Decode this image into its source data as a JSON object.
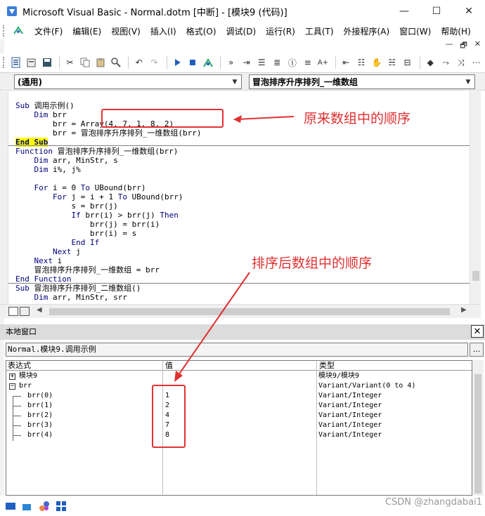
{
  "window": {
    "title": "Microsoft Visual Basic - Normal.dotm [中断] - [模块9 (代码)]",
    "buttons": {
      "minimize": "—",
      "maximize": "☐",
      "close": "✕"
    }
  },
  "menu": [
    "文件(F)",
    "编辑(E)",
    "视图(V)",
    "插入(I)",
    "格式(O)",
    "调试(D)",
    "运行(R)",
    "工具(T)",
    "外接程序(A)",
    "窗口(W)",
    "帮助(H)"
  ],
  "mdi": {
    "minimize": "—",
    "restore": "🗗",
    "close": "✕"
  },
  "combos": {
    "object": "(通用)",
    "procedure": "冒泡排序升序排列_一维数组"
  },
  "code": {
    "lines": [
      {
        "segments": [
          {
            "t": "Sub ",
            "kw": true
          },
          {
            "t": "调用示例()"
          }
        ]
      },
      {
        "segments": [
          {
            "t": "    "
          },
          {
            "t": "Dim",
            "kw": true
          },
          {
            "t": " brr"
          }
        ]
      },
      {
        "segments": [
          {
            "t": "        brr = Array(4, 7, 1, 8, 2)"
          }
        ]
      },
      {
        "segments": [
          {
            "t": "        brr = 冒泡排序升序排列_一维数组(brr)"
          }
        ]
      },
      {
        "segments": [
          {
            "t": "End Sub",
            "kw": true,
            "hl": true
          }
        ]
      },
      {
        "segments": [
          {
            "t": "Function ",
            "kw": true
          },
          {
            "t": "冒泡排序升序排列_一维数组(brr)"
          }
        ]
      },
      {
        "segments": [
          {
            "t": "    "
          },
          {
            "t": "Dim",
            "kw": true
          },
          {
            "t": " arr, MinStr, s"
          }
        ]
      },
      {
        "segments": [
          {
            "t": "    "
          },
          {
            "t": "Dim",
            "kw": true
          },
          {
            "t": " i%, j%"
          }
        ]
      },
      {
        "segments": [
          {
            "t": ""
          }
        ]
      },
      {
        "segments": [
          {
            "t": "    "
          },
          {
            "t": "For",
            "kw": true
          },
          {
            "t": " i = 0 "
          },
          {
            "t": "To",
            "kw": true
          },
          {
            "t": " UBound(brr)"
          }
        ]
      },
      {
        "segments": [
          {
            "t": "        "
          },
          {
            "t": "For",
            "kw": true
          },
          {
            "t": " j = i + 1 "
          },
          {
            "t": "To",
            "kw": true
          },
          {
            "t": " UBound(brr)"
          }
        ]
      },
      {
        "segments": [
          {
            "t": "            s = brr(j)"
          }
        ]
      },
      {
        "segments": [
          {
            "t": "            "
          },
          {
            "t": "If",
            "kw": true
          },
          {
            "t": " brr(i) > brr(j) "
          },
          {
            "t": "Then",
            "kw": true
          }
        ]
      },
      {
        "segments": [
          {
            "t": "                brr(j) = brr(i)"
          }
        ]
      },
      {
        "segments": [
          {
            "t": "                brr(i) = s"
          }
        ]
      },
      {
        "segments": [
          {
            "t": "            "
          },
          {
            "t": "End If",
            "kw": true
          }
        ]
      },
      {
        "segments": [
          {
            "t": "        "
          },
          {
            "t": "Next",
            "kw": true
          },
          {
            "t": " j"
          }
        ]
      },
      {
        "segments": [
          {
            "t": "    "
          },
          {
            "t": "Next",
            "kw": true
          },
          {
            "t": " i"
          }
        ]
      },
      {
        "segments": [
          {
            "t": "    冒泡排序升序排列_一维数组 = brr"
          }
        ]
      },
      {
        "segments": [
          {
            "t": "End Function",
            "kw": true
          }
        ]
      },
      {
        "segments": [
          {
            "t": "Sub ",
            "kw": true
          },
          {
            "t": "冒泡排序升序排列_二维数组()"
          }
        ]
      },
      {
        "segments": [
          {
            "t": "    "
          },
          {
            "t": "Dim",
            "kw": true
          },
          {
            "t": " arr, MinStr, srr"
          }
        ]
      }
    ]
  },
  "locals": {
    "title": "本地窗口",
    "close": "✕",
    "context": "Normal.模块9.调用示例",
    "context_button": "...",
    "headers": {
      "expr": "表达式",
      "value": "值",
      "type": "类型"
    },
    "rows": [
      {
        "expr": "模块9",
        "value": "",
        "type": "模块9/模块9",
        "expander": "+"
      },
      {
        "expr": "brr",
        "value": "",
        "type": "Variant/Variant(0 to 4)",
        "expander": "−"
      },
      {
        "expr": "brr(0)",
        "value": "1",
        "type": "Variant/Integer"
      },
      {
        "expr": "brr(1)",
        "value": "2",
        "type": "Variant/Integer"
      },
      {
        "expr": "brr(2)",
        "value": "4",
        "type": "Variant/Integer"
      },
      {
        "expr": "brr(3)",
        "value": "7",
        "type": "Variant/Integer"
      },
      {
        "expr": "brr(4)",
        "value": "8",
        "type": "Variant/Integer"
      }
    ]
  },
  "annotations": {
    "original_order": "原来数组中的顺序",
    "sorted_order": "排序后数组中的顺序"
  },
  "watermark": "CSDN @zhangdabai1",
  "colors": {
    "keyword": "#00007f",
    "highlight": "#ffff00",
    "annotation": "#e03030"
  }
}
